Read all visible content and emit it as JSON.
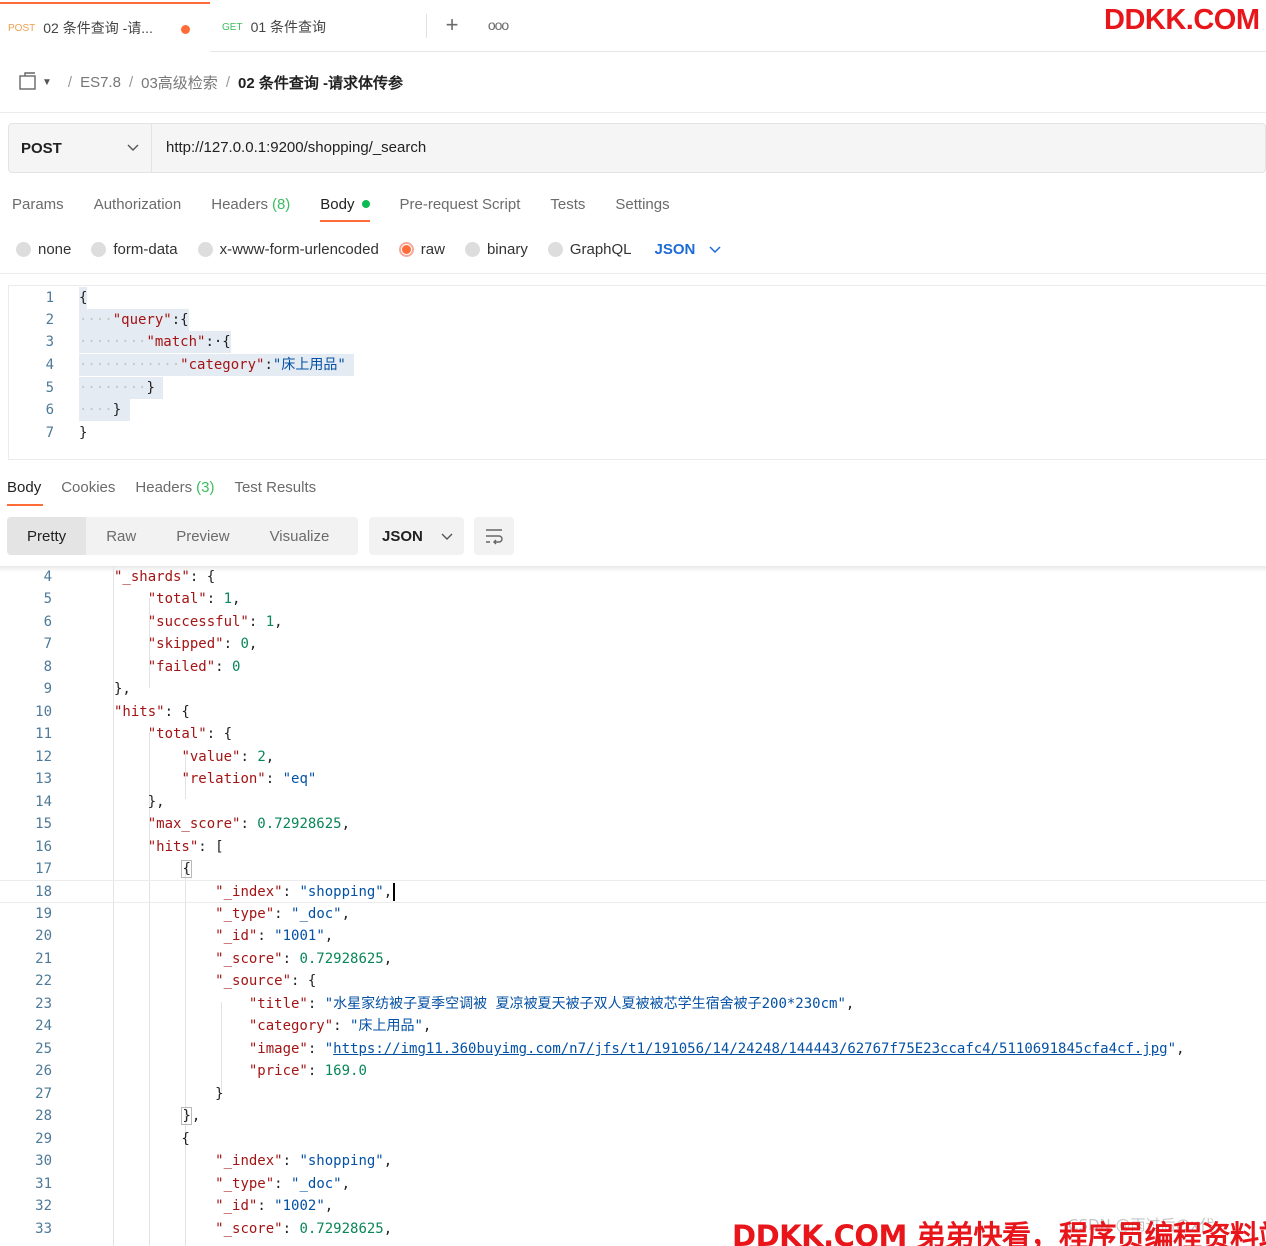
{
  "tabs": [
    {
      "method": "POST",
      "title": "02 条件查询 -请..."
    },
    {
      "method": "GET",
      "title": "01 条件查询"
    }
  ],
  "watermark": {
    "top": "DDKK.COM",
    "bottom": "DDKK.COM 弟弟快看，程序员编程资料站",
    "faint": "CSDN @雨过后のx代"
  },
  "breadcrumb": {
    "items": [
      "ES7.8",
      "03高级检索"
    ],
    "current": "02 条件查询 -请求体传参"
  },
  "request": {
    "method": "POST",
    "url": "http://127.0.0.1:9200/shopping/_search"
  },
  "request_tabs": {
    "params": "Params",
    "authorization": "Authorization",
    "headers": "Headers",
    "headers_count": "(8)",
    "body": "Body",
    "pre_request": "Pre-request Script",
    "tests": "Tests",
    "settings": "Settings"
  },
  "body_types": {
    "none": "none",
    "form_data": "form-data",
    "urlencoded": "x-www-form-urlencoded",
    "raw": "raw",
    "binary": "binary",
    "graphql": "GraphQL",
    "format": "JSON"
  },
  "request_body": {
    "query_key": "\"query\"",
    "match_key": "\"match\"",
    "category_key": "\"category\"",
    "category_value": "\"床上用品\""
  },
  "response_tabs": {
    "body": "Body",
    "cookies": "Cookies",
    "headers": "Headers",
    "headers_count": "(3)",
    "test_results": "Test Results"
  },
  "view_modes": {
    "pretty": "Pretty",
    "raw": "Raw",
    "preview": "Preview",
    "visualize": "Visualize",
    "format": "JSON"
  },
  "response": {
    "shards_total": "1",
    "shards_successful": "1",
    "shards_skipped": "0",
    "shards_failed": "0",
    "hits_total_value": "2",
    "hits_total_relation": "\"eq\"",
    "max_score": "0.72928625",
    "hit1": {
      "index": "\"shopping\"",
      "type": "\"_doc\"",
      "id": "\"1001\"",
      "score": "0.72928625",
      "title": "\"水星家纺被子夏季空调被 夏凉被夏天被子双人夏被被芯学生宿舍被子200*230cm\"",
      "category": "\"床上用品\"",
      "image": "https://img11.360buyimg.com/n7/jfs/t1/191056/14/24248/144443/62767f75E23ccafc4/5110691845cfa4cf.jpg",
      "price": "169.0"
    },
    "hit2": {
      "index": "\"shopping\"",
      "type": "\"_doc\"",
      "id": "\"1002\"",
      "score": "0.72928625"
    }
  }
}
